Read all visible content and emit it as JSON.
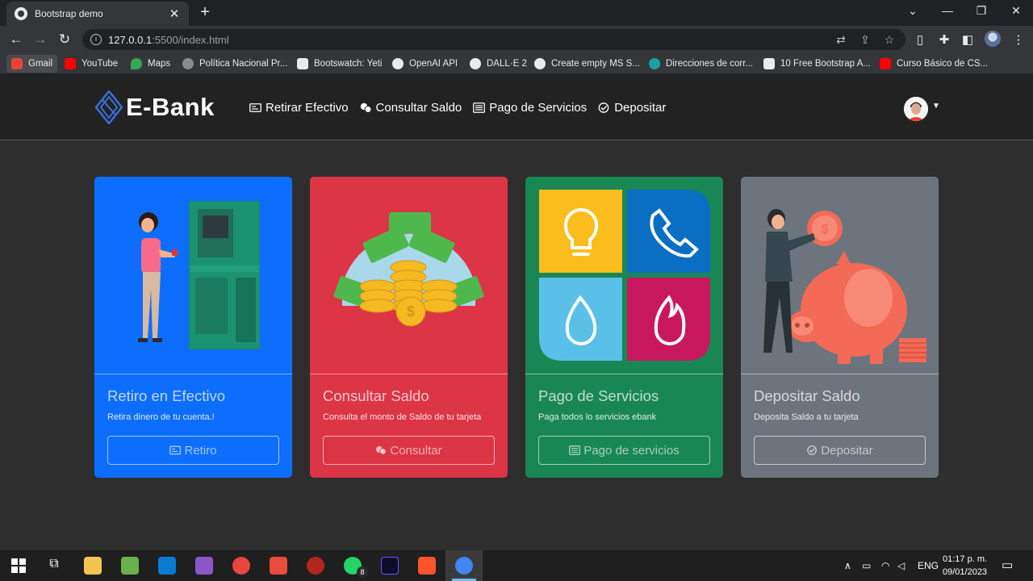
{
  "browser": {
    "tab_title": "Bootstrap demo",
    "tab_close": "✕",
    "new_tab": "+",
    "url_host": "127.0.0.1",
    "url_rest": ":5500/index.html",
    "bookmarks": [
      {
        "label": "Gmail",
        "color": "#ea4335"
      },
      {
        "label": "YouTube",
        "color": "#ff0000"
      },
      {
        "label": "Maps",
        "color": "#34a853"
      },
      {
        "label": "Política Nacional Pr...",
        "color": "#8a8b8f"
      },
      {
        "label": "Bootswatch: Yeti",
        "color": "#e8eaed"
      },
      {
        "label": "OpenAI API",
        "color": "#e8eaed"
      },
      {
        "label": "DALL·E 2",
        "color": "#e8eaed"
      },
      {
        "label": "Create empty MS S...",
        "color": "#e8eaed"
      },
      {
        "label": "Direcciones de corr...",
        "color": "#1aa19c"
      },
      {
        "label": "10 Free Bootstrap A...",
        "color": "#e8eaed"
      },
      {
        "label": "Curso Básico de CS...",
        "color": "#ff0000"
      }
    ]
  },
  "navbar": {
    "brand": "E-Bank",
    "links": [
      "Retirar Efectivo",
      "Consultar Saldo",
      "Pago de Servicios",
      "Depositar"
    ]
  },
  "cards": [
    {
      "title": "Retiro en Efectivo",
      "text": "Retira dinero de tu cuenta.!",
      "button": "Retiro",
      "color": "#0d6efd"
    },
    {
      "title": "Consultar Saldo",
      "text": "Consulta el monto de Saldo de tu tarjeta",
      "button": "Consultar",
      "color": "#dc3545"
    },
    {
      "title": "Pago de Servicios",
      "text": "Paga todos lo servicios ebank",
      "button": "Pago de servicios",
      "color": "#198754"
    },
    {
      "title": "Depositar Saldo",
      "text": "Deposita Saldo a tu tarjeta",
      "button": "Depositar",
      "color": "#6c757d"
    }
  ],
  "taskbar": {
    "whatsapp_badge": "8",
    "language": "ENG",
    "time": "01:17 p. m.",
    "date": "09/01/2023"
  }
}
